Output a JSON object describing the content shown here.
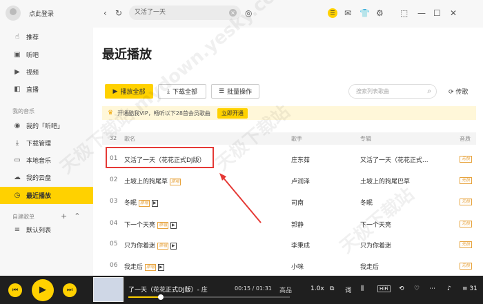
{
  "login_text": "点此登录",
  "sidebar": {
    "top_items": [
      {
        "icon": "thumb-icon",
        "glyph": "☝",
        "label": "推荐"
      },
      {
        "icon": "radio-icon",
        "glyph": "▣",
        "label": "听吧"
      },
      {
        "icon": "video-icon",
        "glyph": "▶",
        "label": "视频"
      },
      {
        "icon": "live-icon",
        "glyph": "◧",
        "label": "直播"
      }
    ],
    "my_music_label": "我的音乐",
    "my_items": [
      {
        "icon": "mic-icon",
        "glyph": "◉",
        "label": "我的「听吧」"
      },
      {
        "icon": "download-icon",
        "glyph": "⤓",
        "label": "下载管理"
      },
      {
        "icon": "computer-icon",
        "glyph": "▭",
        "label": "本地音乐"
      },
      {
        "icon": "cloud-icon",
        "glyph": "☁",
        "label": "我的云盘"
      },
      {
        "icon": "clock-icon",
        "glyph": "◷",
        "label": "最近播放"
      }
    ],
    "created_lists_label": "自建歌单",
    "playlists": [
      {
        "icon": "list-icon",
        "glyph": "≡",
        "label": "默认列表"
      }
    ]
  },
  "topbar": {
    "search_value": "又活了一天"
  },
  "page_title": "最近播放",
  "toolbar": {
    "play_all": "播放全部",
    "download_all": "下载全部",
    "batch": "批量操作",
    "search_placeholder": "搜索列表歌曲",
    "transfer": "传歌"
  },
  "vip_banner": {
    "text": "开通酷我VIP，畅听以下28首会员歌曲",
    "button": "立即开通"
  },
  "table": {
    "count": "32",
    "headers": {
      "title": "歌名",
      "artist": "歌手",
      "album": "专辑",
      "quality": "音质"
    },
    "rows": [
      {
        "num": "01",
        "title": "又活了一天（花花正式DJ版）",
        "artist": "庄东茹",
        "album": "又活了一天（花花正式...",
        "quality": "无损",
        "tags": []
      },
      {
        "num": "02",
        "title": "土坡上的狗尾草",
        "artist": "卢润泽",
        "album": "土坡上的狗尾巴草",
        "quality": "无损",
        "tags": [
          "原唱"
        ]
      },
      {
        "num": "03",
        "title": "冬眠",
        "artist": "司南",
        "album": "冬眠",
        "quality": "无损",
        "tags": [
          "原唱",
          "▶"
        ]
      },
      {
        "num": "04",
        "title": "下一个天亮",
        "artist": "郭静",
        "album": "下一个天亮",
        "quality": "无损",
        "tags": [
          "原唱",
          "▶"
        ]
      },
      {
        "num": "05",
        "title": "只为你着迷",
        "artist": "李秉成",
        "album": "只为你着迷",
        "quality": "无损",
        "tags": [
          "原唱",
          "▶"
        ]
      },
      {
        "num": "06",
        "title": "我走后",
        "artist": "小咪",
        "album": "我走后",
        "quality": "无损",
        "tags": [
          "原唱",
          "▶"
        ]
      }
    ]
  },
  "player": {
    "now_playing": "了一天（花花正式DJ版）- 庄",
    "time": "00:15 / 01:31",
    "quality": "高品",
    "speed": "1.0x",
    "hifi": "HiFi",
    "count": "31",
    "progress": 0.2
  },
  "watermark": "天极下载站 mydown.yesky.com"
}
